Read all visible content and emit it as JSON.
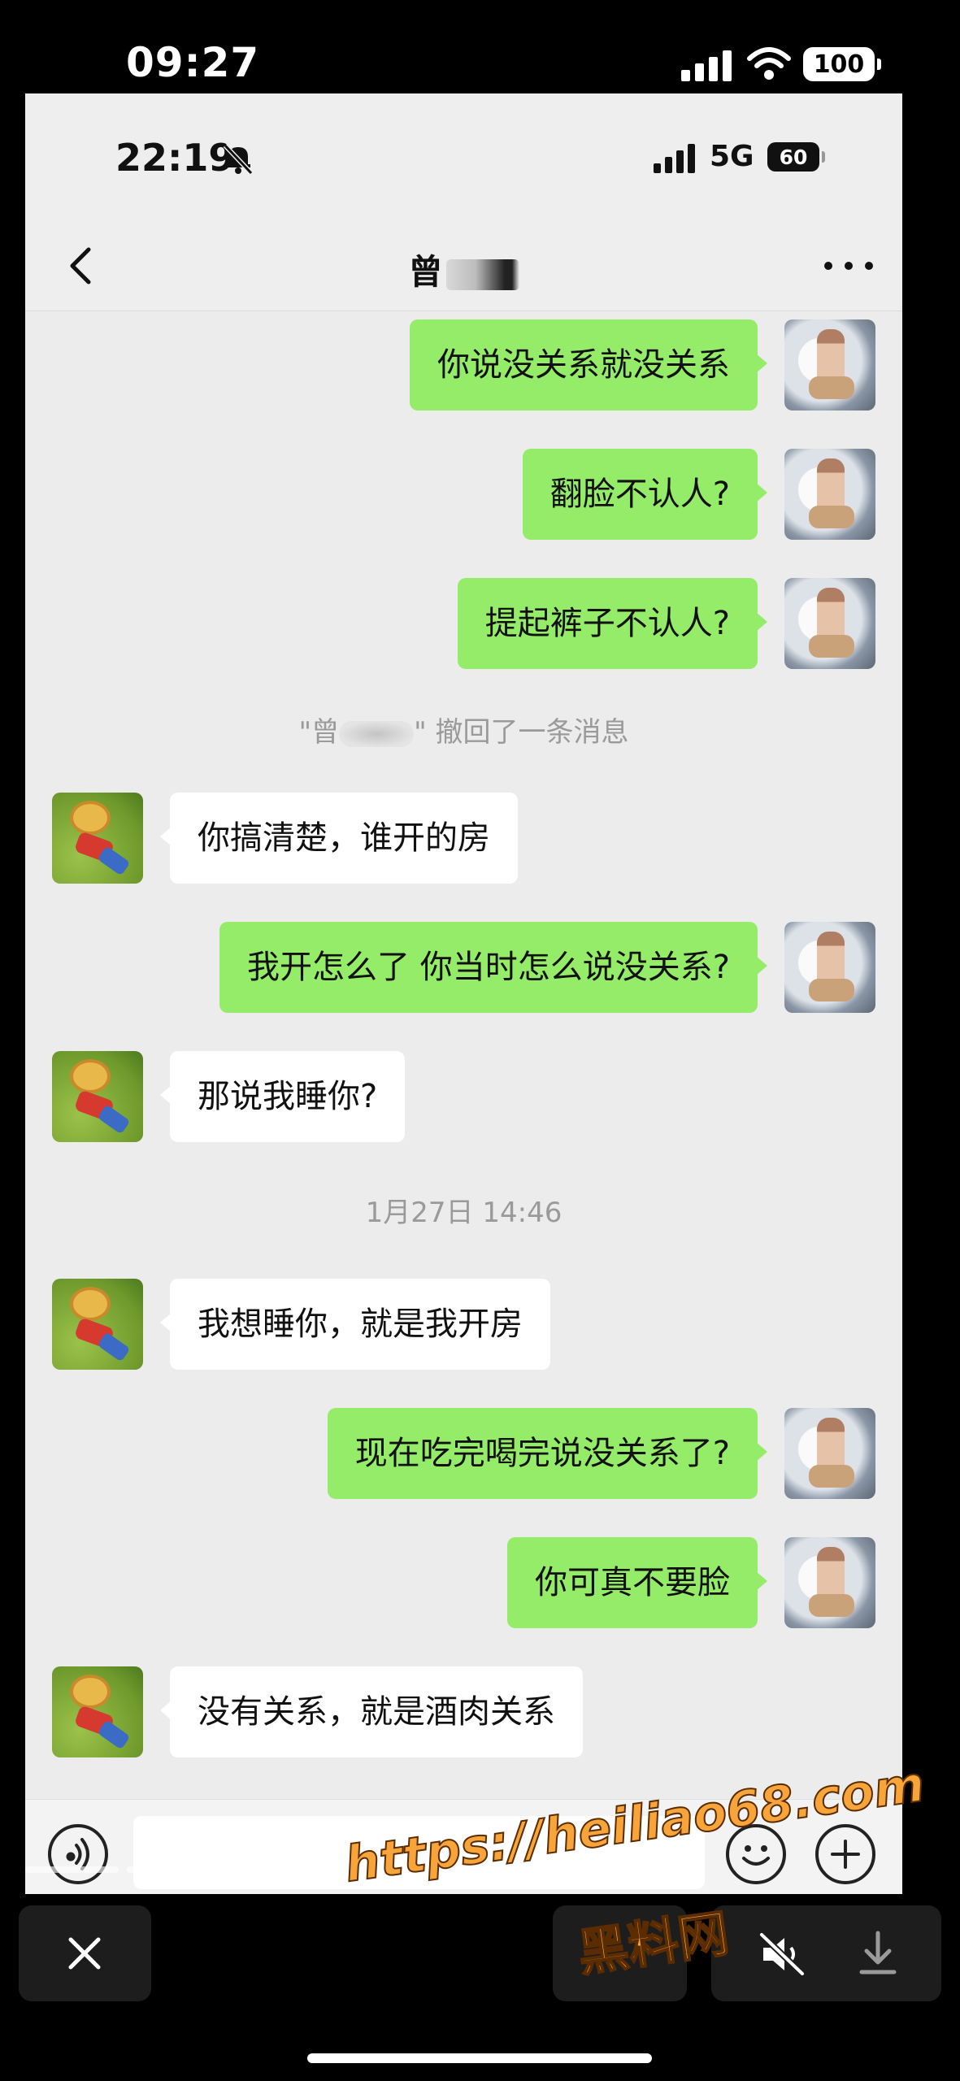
{
  "outer_status": {
    "time": "09:27",
    "battery": "100"
  },
  "inner_status": {
    "time": "22:19",
    "network": "5G",
    "battery": "60"
  },
  "nav": {
    "title": "曾"
  },
  "messages": [
    {
      "side": "me",
      "text": "你说没关系就没关系"
    },
    {
      "side": "me",
      "text": "翻脸不认人?"
    },
    {
      "side": "me",
      "text": "提起裤子不认人?"
    },
    {
      "side": "system",
      "text_before": "\"曾",
      "text_after": "\" 撤回了一条消息"
    },
    {
      "side": "them",
      "text": "你搞清楚，谁开的房"
    },
    {
      "side": "me",
      "text": "我开怎么了 你当时怎么说没关系?"
    },
    {
      "side": "them",
      "text": "那说我睡你?"
    },
    {
      "side": "time",
      "text": "1月27日 14:46"
    },
    {
      "side": "them",
      "text": "我想睡你，就是我开房"
    },
    {
      "side": "me",
      "text": "现在吃完喝完说没关系了?"
    },
    {
      "side": "me",
      "text": "你可真不要脸"
    },
    {
      "side": "them",
      "text": "没有关系，就是酒肉关系"
    }
  ],
  "watermark": {
    "url": "https://heiliao68.com",
    "label": "黑料网"
  },
  "icons": {
    "back": "chevron-left-icon",
    "more": "more-dots-icon",
    "voice": "voice-icon",
    "emoji": "emoji-icon",
    "plus": "plus-icon",
    "close": "close-icon",
    "mute": "mute-icon",
    "download": "download-icon"
  },
  "colors": {
    "my_bubble": "#95ec69",
    "their_bubble": "#ffffff",
    "chat_bg": "#ececec",
    "watermark": "#f7a53a"
  }
}
